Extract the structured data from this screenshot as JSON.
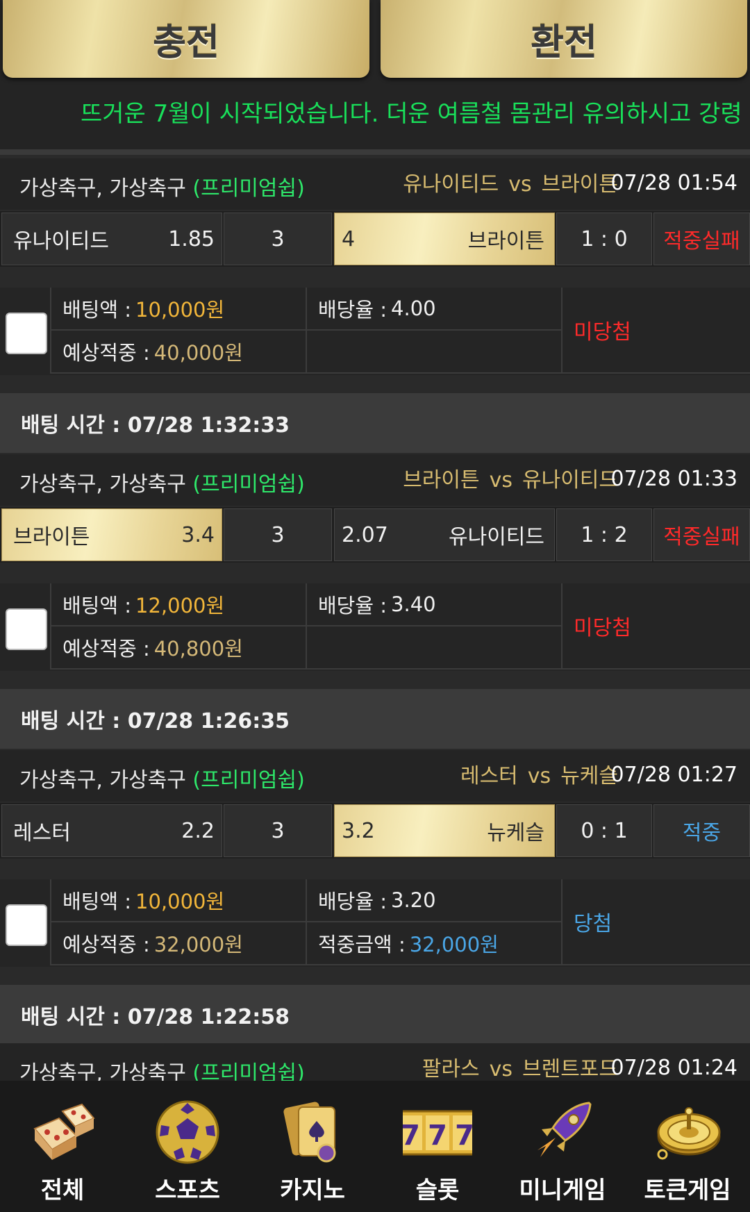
{
  "header": {
    "deposit_label": "충전",
    "withdraw_label": "환전",
    "notice": "뜨거운 7월이 시작되었습니다. 더운 여름철 몸관리 유의하시고 강령"
  },
  "bets": [
    {
      "league": "가상축구, 가상축구",
      "premium": "(프리미엄쉽)",
      "home": "유나이티드",
      "vs": "vs",
      "away": "브라이튼",
      "datetime": "07/28 01:54",
      "home_name": "유나이티드",
      "home_odds": "1.85",
      "draw": "3",
      "away_odds": "4",
      "away_name": "브라이튼",
      "score": "1 : 0",
      "result": "적중실패",
      "bet_label": "배팅액 :",
      "bet_amount": "10,000원",
      "rate_label": "배당율 :",
      "rate": "4.00",
      "expect_label": "예상적중 :",
      "expect": "40,000원",
      "win_label": "",
      "win_amount": "",
      "status": "미당첨"
    },
    {
      "time_label": "배팅 시간 : 07/28 1:32:33",
      "league": "가상축구, 가상축구",
      "premium": "(프리미엄쉽)",
      "home": "브라이튼",
      "vs": "vs",
      "away": "유나이티드",
      "datetime": "07/28 01:33",
      "home_name": "브라이튼",
      "home_odds": "3.4",
      "draw": "3",
      "away_odds": "2.07",
      "away_name": "유나이티드",
      "score": "1 : 2",
      "result": "적중실패",
      "bet_label": "배팅액 :",
      "bet_amount": "12,000원",
      "rate_label": "배당율 :",
      "rate": "3.40",
      "expect_label": "예상적중 :",
      "expect": "40,800원",
      "win_label": "",
      "win_amount": "",
      "status": "미당첨"
    },
    {
      "time_label": "배팅 시간 : 07/28 1:26:35",
      "league": "가상축구, 가상축구",
      "premium": "(프리미엄쉽)",
      "home": "레스터",
      "vs": "vs",
      "away": "뉴케슬",
      "datetime": "07/28 01:27",
      "home_name": "레스터",
      "home_odds": "2.2",
      "draw": "3",
      "away_odds": "3.2",
      "away_name": "뉴케슬",
      "score": "0 : 1",
      "result": "적중",
      "bet_label": "배팅액 :",
      "bet_amount": "10,000원",
      "rate_label": "배당율 :",
      "rate": "3.20",
      "expect_label": "예상적중 :",
      "expect": "32,000원",
      "win_label": "적중금액 :",
      "win_amount": "32,000원",
      "status": "당첨"
    },
    {
      "time_label": "배팅 시간 : 07/28 1:22:58",
      "league": "가상축구, 가상축구",
      "premium": "(프리미엄쉽)",
      "home": "팔라스",
      "vs": "vs",
      "away": "브렌트포드",
      "datetime": "07/28 01:24"
    }
  ],
  "nav": [
    {
      "label": "전체",
      "icon": "dice-icon"
    },
    {
      "label": "스포츠",
      "icon": "soccer-ball-icon"
    },
    {
      "label": "카지노",
      "icon": "playing-cards-icon"
    },
    {
      "label": "슬롯",
      "icon": "slot-777-icon"
    },
    {
      "label": "미니게임",
      "icon": "rocket-icon"
    },
    {
      "label": "토큰게임",
      "icon": "roulette-icon"
    }
  ],
  "colors": {
    "gold": "#f2b63a",
    "fail": "#ff2a2a",
    "win": "#4aa6e6",
    "notice": "#19e05a"
  }
}
